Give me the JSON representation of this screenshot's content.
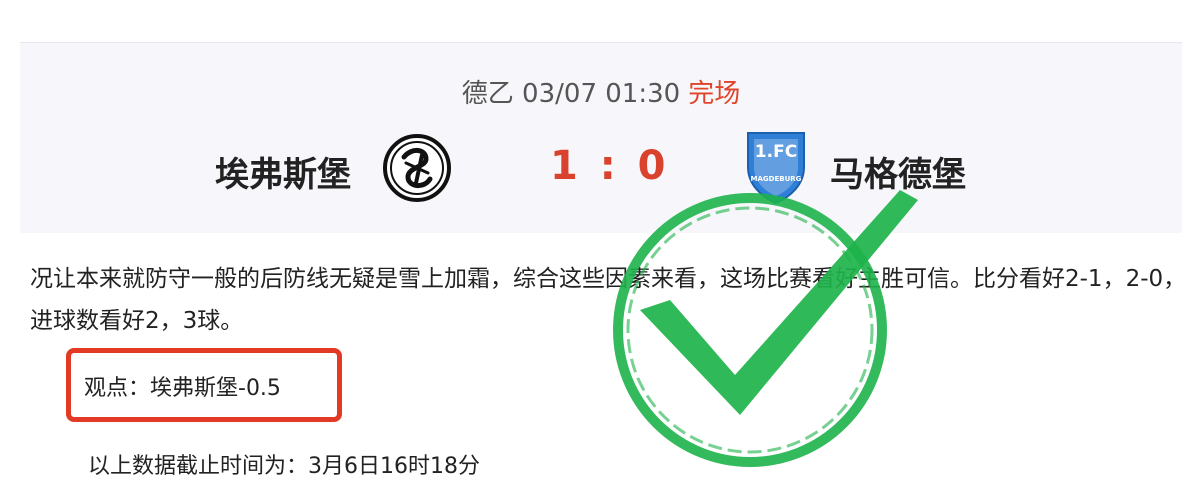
{
  "match": {
    "league_time": "德乙 03/07 01:30",
    "status": "完场",
    "home_team": "埃弗斯堡",
    "away_team": "马格德堡",
    "score": "1 : 0",
    "away_logo_text_top": "1.FC",
    "away_logo_text_side": "MAGDEBURG"
  },
  "article": {
    "analysis": "况让本来就防守一般的后防线无疑是雪上加霜，综合这些因素来看，这场比赛看好主胜可信。比分看好2-1，2-0，进球数看好2，3球。",
    "viewpoint": "观点：埃弗斯堡-0.5",
    "cutoff": "以上数据截止时间为：3月6日16时18分"
  },
  "colors": {
    "status_red": "#e0442a",
    "score_red": "#d9432e",
    "highlight_box_red": "#e33a25",
    "check_green": "#1db34a",
    "away_logo_blue": "#2f7fd6"
  },
  "icons": {
    "home_logo": "elversberg-crest-icon",
    "away_logo": "magdeburg-crest-icon",
    "stamp": "green-checkmark-stamp-icon"
  }
}
